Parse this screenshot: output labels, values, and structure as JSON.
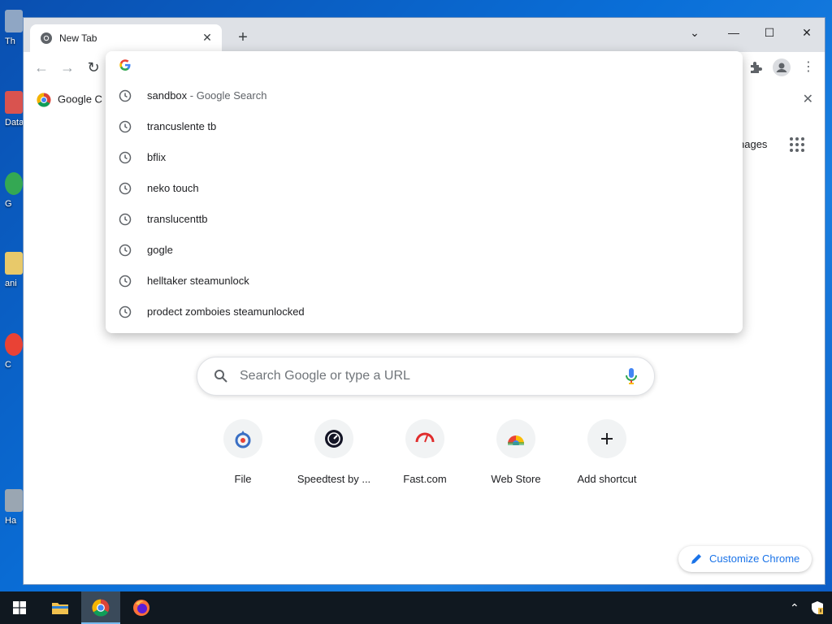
{
  "desktop": {
    "icons": [
      {
        "label": "Th",
        "color": "#8fa6c4"
      },
      {
        "label": "Data",
        "color": "#d9534f"
      },
      {
        "label": "G",
        "color": "#34a853"
      },
      {
        "label": "ani",
        "color": "#e8c96a"
      },
      {
        "label": "C",
        "color": "#e94235"
      },
      {
        "label": "Ha",
        "color": "#9aa6b2"
      }
    ]
  },
  "browser": {
    "tab": {
      "title": "New Tab",
      "close": "✕"
    },
    "new_tab": "+",
    "window_controls": {
      "tab_search": "⌄",
      "minimize": "—",
      "maximize": "☐",
      "close": "✕"
    },
    "toolbar": {
      "back": "←",
      "forward": "→",
      "reload": "↻",
      "extensions": "puzzle-icon",
      "profile": "profile-icon",
      "menu": "⋮"
    },
    "bookmarks_bar": {
      "item_label": "Google C",
      "close": "✕"
    }
  },
  "omnibox": {
    "input_value": "",
    "suggestions": [
      {
        "text": "sandbox",
        "suffix": " - Google Search"
      },
      {
        "text": "trancuslente tb",
        "suffix": ""
      },
      {
        "text": "bflix",
        "suffix": ""
      },
      {
        "text": "neko touch",
        "suffix": ""
      },
      {
        "text": "translucenttb",
        "suffix": ""
      },
      {
        "text": "gogle",
        "suffix": ""
      },
      {
        "text": "helltaker steamunlock",
        "suffix": ""
      },
      {
        "text": "prodect zomboies steamunlocked",
        "suffix": ""
      }
    ]
  },
  "ntp": {
    "images_link": "nages",
    "search_placeholder": "Search Google or type a URL",
    "shortcuts": [
      {
        "label": "File"
      },
      {
        "label": "Speedtest by ..."
      },
      {
        "label": "Fast.com"
      },
      {
        "label": "Web Store"
      },
      {
        "label": "Add shortcut"
      }
    ],
    "customize_label": "Customize Chrome"
  },
  "colors": {
    "accent": "#1a73e8",
    "taskbar": "#101820"
  }
}
